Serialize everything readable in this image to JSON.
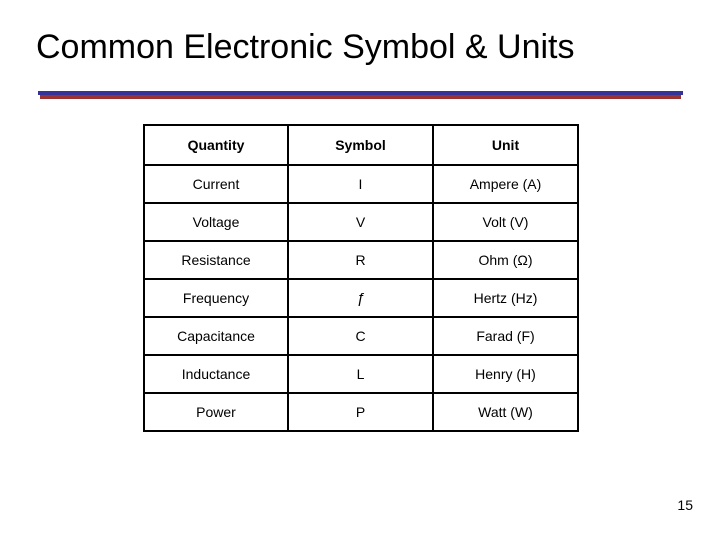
{
  "slide": {
    "title": "Common Electronic Symbol & Units",
    "page_number": "15",
    "accent_colors": {
      "rule_top": "#333399",
      "rule_bottom": "#993333",
      "text": "#000000",
      "background": "#ffffff",
      "table_border": "#000000"
    }
  },
  "table": {
    "headers": [
      "Quantity",
      "Symbol",
      "Unit"
    ],
    "rows": [
      {
        "quantity": "Current",
        "symbol": "I",
        "unit": "Ampere (A)"
      },
      {
        "quantity": "Voltage",
        "symbol": "V",
        "unit": "Volt (V)"
      },
      {
        "quantity": "Resistance",
        "symbol": "R",
        "unit": "Ohm (Ω)"
      },
      {
        "quantity": "Frequency",
        "symbol": "ƒ",
        "unit": "Hertz (Hz)"
      },
      {
        "quantity": "Capacitance",
        "symbol": "C",
        "unit": "Farad (F)"
      },
      {
        "quantity": "Inductance",
        "symbol": "L",
        "unit": "Henry (H)"
      },
      {
        "quantity": "Power",
        "symbol": "P",
        "unit": "Watt (W)"
      }
    ]
  }
}
